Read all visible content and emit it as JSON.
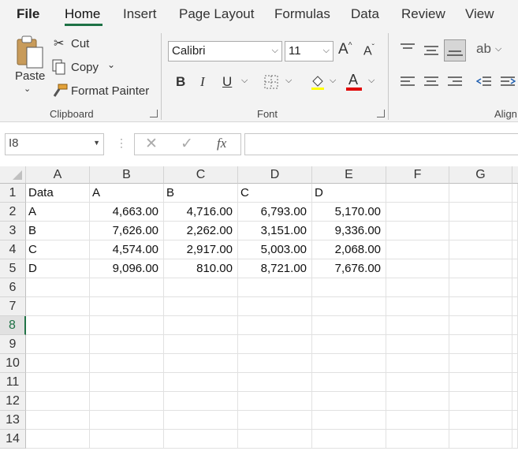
{
  "menu": {
    "file": "File",
    "tabs": [
      "Home",
      "Insert",
      "Page Layout",
      "Formulas",
      "Data",
      "Review",
      "View"
    ]
  },
  "clipboard": {
    "paste": "Paste",
    "cut": "Cut",
    "copy": "Copy",
    "format_painter": "Format Painter",
    "group_label": "Clipboard"
  },
  "font": {
    "name": "Calibri",
    "size": "11",
    "bold": "B",
    "italic": "I",
    "underline": "U",
    "font_color_glyph": "A",
    "grow_glyph": "A",
    "shrink_glyph": "A",
    "group_label": "Font"
  },
  "alignment": {
    "group_label": "Align"
  },
  "formula_bar": {
    "name_box": "I8",
    "fx": "fx",
    "content": ""
  },
  "sheet": {
    "columns": [
      "A",
      "B",
      "C",
      "D",
      "E",
      "F",
      "G"
    ],
    "rows": [
      "1",
      "2",
      "3",
      "4",
      "5",
      "6",
      "7",
      "8",
      "9",
      "10",
      "11",
      "12",
      "13",
      "14"
    ],
    "selected_row": "8",
    "cells": [
      [
        "Data",
        "A",
        "B",
        "C",
        "D"
      ],
      [
        "A",
        "4,663.00",
        "4,716.00",
        "6,793.00",
        "5,170.00"
      ],
      [
        "B",
        "7,626.00",
        "2,262.00",
        "3,151.00",
        "9,336.00"
      ],
      [
        "C",
        "4,574.00",
        "2,917.00",
        "5,003.00",
        "2,068.00"
      ],
      [
        "D",
        "9,096.00",
        "810.00",
        "8,721.00",
        "7,676.00"
      ]
    ]
  },
  "colors": {
    "accent": "#217346",
    "font_color_bar": "#e00000",
    "ribbon_bg": "#f3f3f3"
  }
}
